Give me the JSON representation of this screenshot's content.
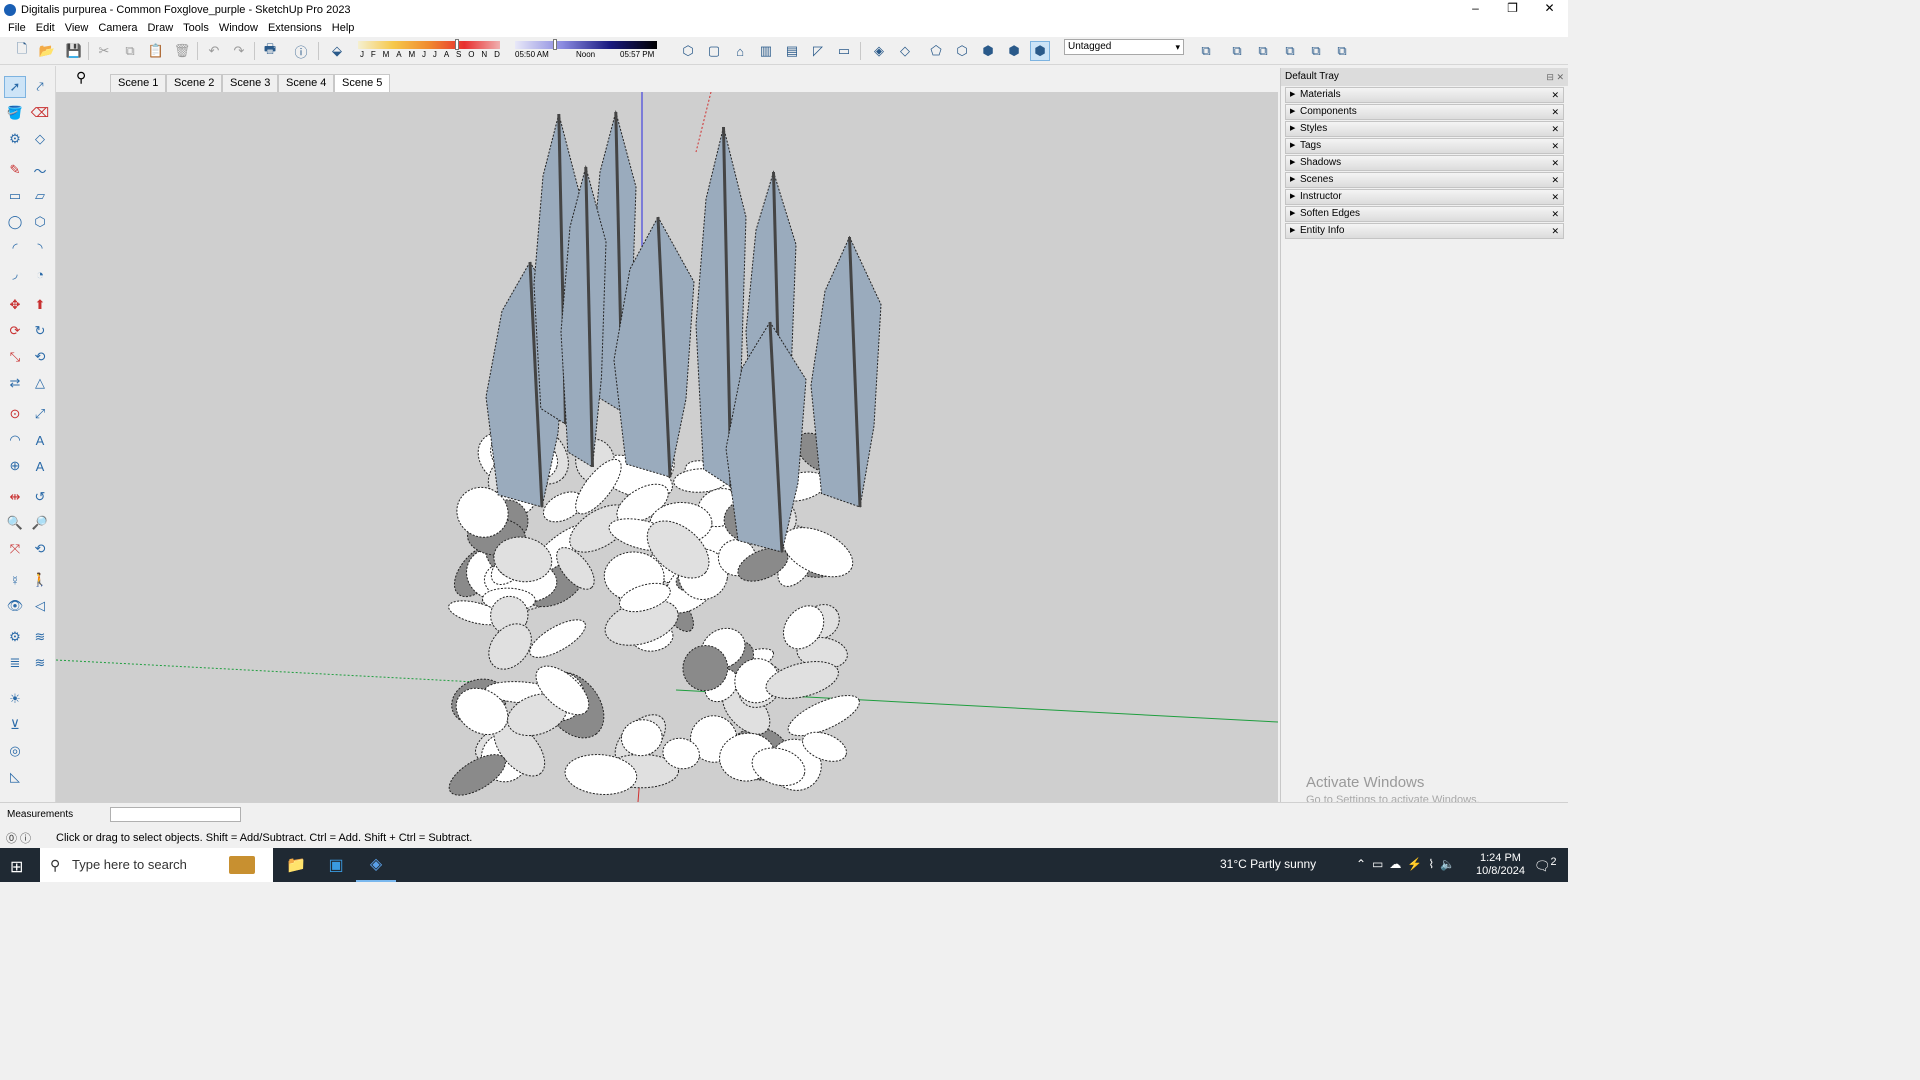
{
  "window": {
    "title": "Digitalis purpurea - Common Foxglove_purple - SketchUp Pro 2023",
    "controls": [
      "–",
      "❐",
      "✕"
    ]
  },
  "menu": [
    "File",
    "Edit",
    "View",
    "Camera",
    "Draw",
    "Tools",
    "Window",
    "Extensions",
    "Help"
  ],
  "shadows": {
    "months": [
      "J",
      "F",
      "M",
      "A",
      "M",
      "J",
      "J",
      "A",
      "S",
      "O",
      "N",
      "D"
    ],
    "time_start": "05:50 AM",
    "time_mid": "Noon",
    "time_end": "05:57 PM",
    "month_slider_value": 0.7,
    "time_slider_value": 0.28
  },
  "tag_select": {
    "value": "Untagged"
  },
  "scenes": [
    "Scene 1",
    "Scene 2",
    "Scene 3",
    "Scene 4",
    "Scene 5"
  ],
  "tray": {
    "title": "Default Tray",
    "panels": [
      "Materials",
      "Components",
      "Styles",
      "Tags",
      "Shadows",
      "Scenes",
      "Instructor",
      "Soften Edges",
      "Entity Info"
    ]
  },
  "watermark": {
    "line1": "Activate Windows",
    "line2": "Go to Settings to activate Windows."
  },
  "measurements": {
    "label": "Measurements",
    "value": ""
  },
  "status": {
    "text": "Click or drag to select objects. Shift = Add/Subtract. Ctrl = Add. Shift + Ctrl = Subtract."
  },
  "taskbar": {
    "search_placeholder": "Type here to search",
    "weather": "31°C  Partly sunny",
    "time": "1:24 PM",
    "date": "10/8/2024",
    "notifications": "2"
  },
  "colors": {
    "viewport_bg": "#cfcfcf",
    "leaf_face": "#9aabbd",
    "leaf_back": "#ffffff",
    "axis_green": "#1e9e3e",
    "axis_blue": "#2a2ae0",
    "axis_red": "#d03030"
  }
}
